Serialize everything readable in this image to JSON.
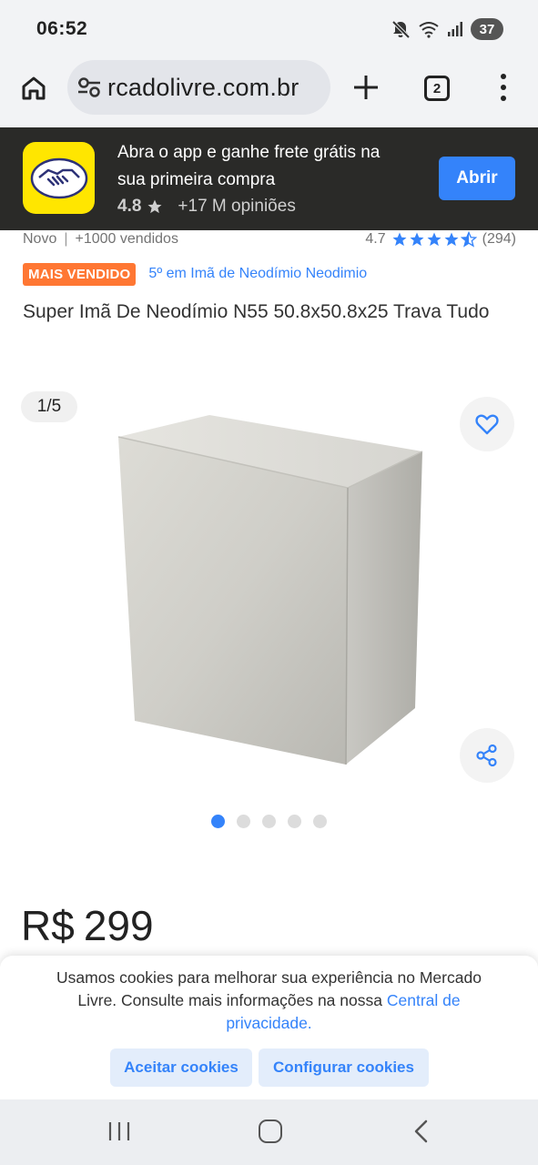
{
  "status_bar": {
    "time": "06:52",
    "battery": "37",
    "icons": [
      "mute-icon",
      "wifi-icon",
      "signal-icon",
      "battery-icon"
    ]
  },
  "browser": {
    "url": "rcadolivre.com.br",
    "tab_count": "2",
    "icons": [
      "home-icon",
      "site-settings-icon",
      "plus-icon",
      "tabs-icon",
      "menu-icon"
    ]
  },
  "app_banner": {
    "title": "Abra o app e ganhe frete grátis na sua primeira compra",
    "rating": "4.8",
    "opinions": "+17 M opiniões",
    "open_label": "Abrir",
    "logo_color": "#ffe600"
  },
  "product": {
    "condition": "Novo",
    "sold": "+1000 vendidos",
    "rating": "4.7",
    "rating_value": 4.7,
    "review_count": "(294)",
    "badge": "MAIS VENDIDO",
    "ranking": "5º em Imã de Neodímio Neodimio",
    "title": "Super Imã De Neodímio N55 50.8x50.8x25 Trava Tudo",
    "image_counter": "1/5",
    "image_count": 5,
    "active_image": 1,
    "price_currency": "R$",
    "price_value": "299"
  },
  "cookies": {
    "text": "Usamos cookies para melhorar sua experiência no Mercado Livre. Consulte mais informações na nossa",
    "link": "Central de privacidade.",
    "accept_label": "Aceitar cookies",
    "configure_label": "Configurar cookies"
  },
  "colors": {
    "accent": "#3483fa",
    "badge": "#ff7733",
    "banner_bg": "#2a2a28"
  }
}
